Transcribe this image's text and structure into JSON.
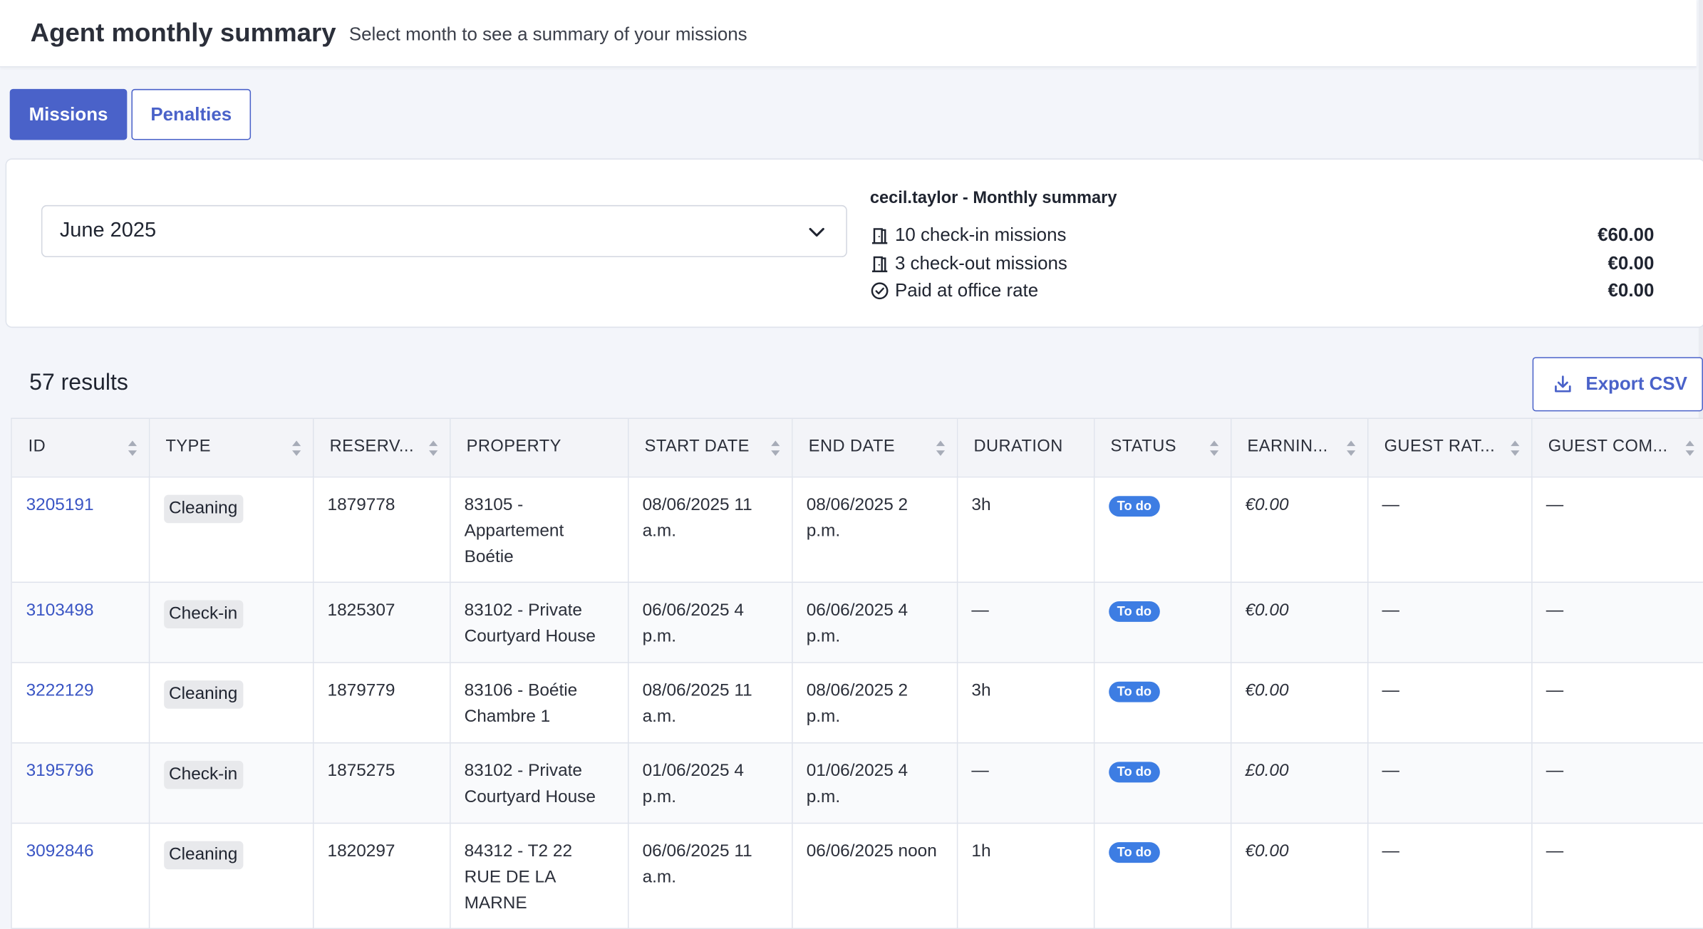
{
  "header": {
    "title": "Agent monthly summary",
    "subtitle": "Select month to see a summary of your missions"
  },
  "tabs": [
    {
      "label": "Missions",
      "active": true
    },
    {
      "label": "Penalties",
      "active": false
    }
  ],
  "month_select": {
    "value": "June 2025"
  },
  "summary": {
    "heading": "cecil.taylor - Monthly summary",
    "lines": [
      {
        "icon": "door-icon",
        "label": "10 check-in missions",
        "amount": "€60.00"
      },
      {
        "icon": "door-icon",
        "label": "3 check-out missions",
        "amount": "€0.00"
      },
      {
        "icon": "check-circle-icon",
        "label": "Paid at office rate",
        "amount": "€0.00"
      }
    ]
  },
  "results": {
    "count_label": "57 results",
    "export_label": "Export CSV"
  },
  "table": {
    "columns": [
      "ID",
      "TYPE",
      "RESERV...",
      "PROPERTY",
      "START DATE",
      "END DATE",
      "DURATION",
      "STATUS",
      "EARNIN...",
      "GUEST RAT...",
      "GUEST COM..."
    ],
    "rows": [
      {
        "id": "3205191",
        "type": "Cleaning",
        "reservation": "1879778",
        "property": "83105 - Appartement Boétie",
        "start": "08/06/2025 11 a.m.",
        "end": "08/06/2025 2 p.m.",
        "duration": "3h",
        "status": "To do",
        "earnings": "€0.00",
        "guest_rating": "—",
        "guest_comment": "—"
      },
      {
        "id": "3103498",
        "type": "Check-in",
        "reservation": "1825307",
        "property": "83102 - Private Courtyard House",
        "start": "06/06/2025 4 p.m.",
        "end": "06/06/2025 4 p.m.",
        "duration": "—",
        "status": "To do",
        "earnings": "€0.00",
        "guest_rating": "—",
        "guest_comment": "—"
      },
      {
        "id": "3222129",
        "type": "Cleaning",
        "reservation": "1879779",
        "property": "83106 - Boétie Chambre 1",
        "start": "08/06/2025 11 a.m.",
        "end": "08/06/2025 2 p.m.",
        "duration": "3h",
        "status": "To do",
        "earnings": "€0.00",
        "guest_rating": "—",
        "guest_comment": "—"
      },
      {
        "id": "3195796",
        "type": "Check-in",
        "reservation": "1875275",
        "property": "83102 - Private Courtyard House",
        "start": "01/06/2025 4 p.m.",
        "end": "01/06/2025 4 p.m.",
        "duration": "—",
        "status": "To do",
        "earnings": "£0.00",
        "guest_rating": "—",
        "guest_comment": "—"
      },
      {
        "id": "3092846",
        "type": "Cleaning",
        "reservation": "1820297",
        "property": "84312 - T2 22 RUE DE LA MARNE",
        "start": "06/06/2025 11 a.m.",
        "end": "06/06/2025 noon",
        "duration": "1h",
        "status": "To do",
        "earnings": "€0.00",
        "guest_rating": "—",
        "guest_comment": "—"
      }
    ]
  },
  "colors": {
    "accent": "#4a62c9",
    "badge": "#3d7de3",
    "link": "#3a55c4"
  }
}
